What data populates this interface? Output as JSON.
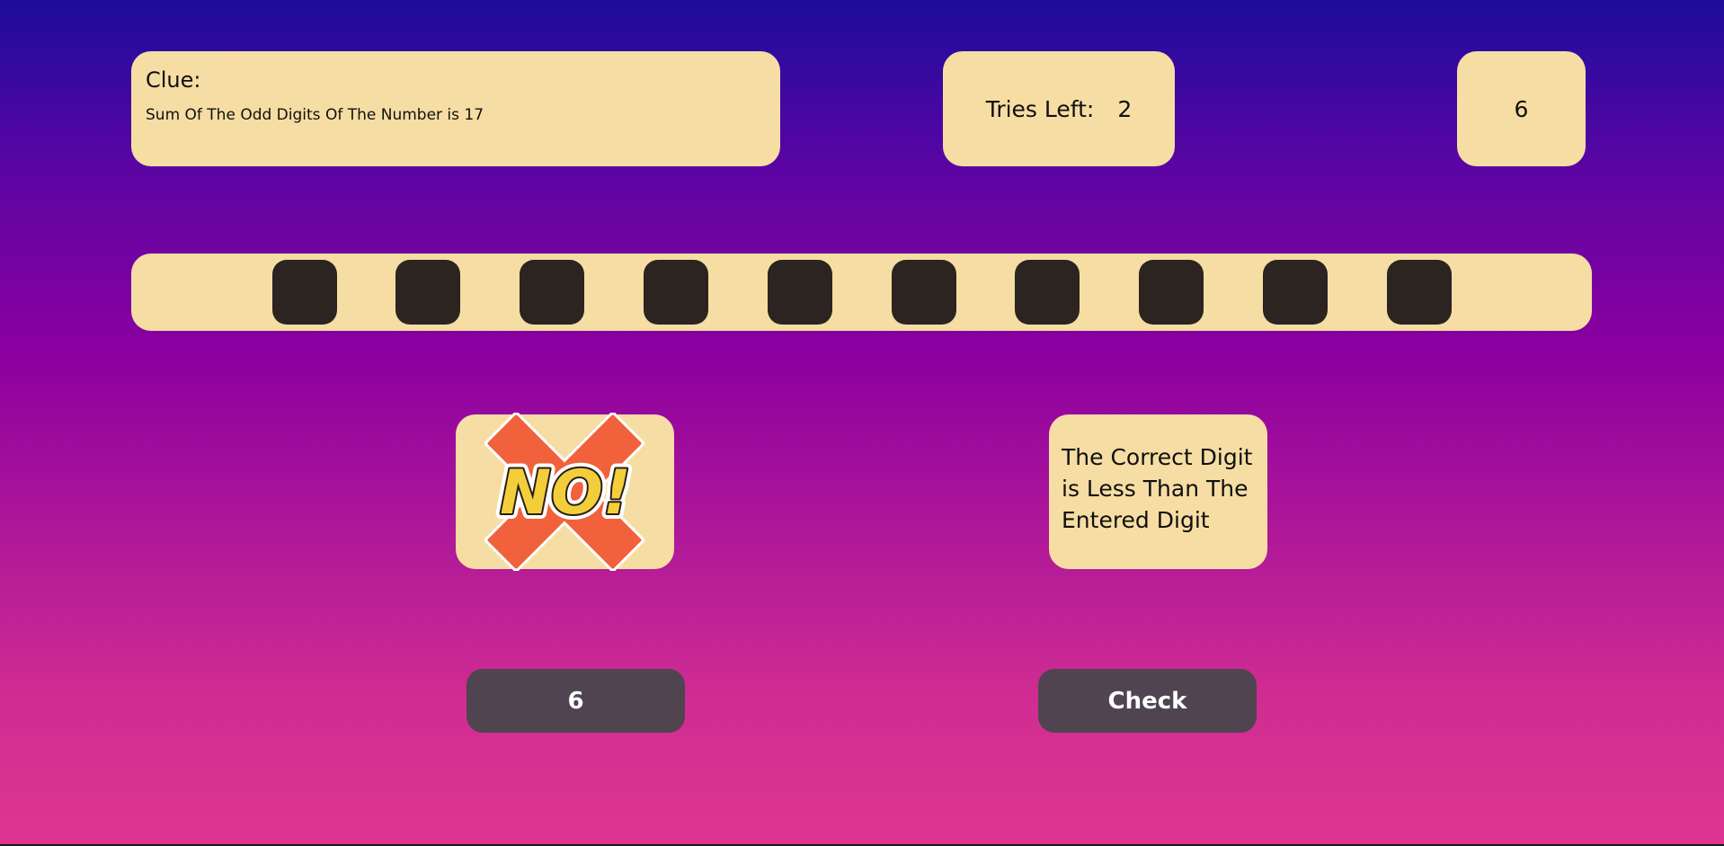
{
  "clue": {
    "heading": "Clue:",
    "text": "Sum Of The Odd Digits Of The Number is 17"
  },
  "tries": {
    "label": "Tries Left:",
    "value": "2"
  },
  "score": {
    "value": "6"
  },
  "slots": {
    "count": 10,
    "color": "#2b2420"
  },
  "verdict": {
    "stamp_text": "NO!",
    "icon": "no-x-icon"
  },
  "hint": {
    "text": "The Correct Digit is Less Than The Entered Digit"
  },
  "controls": {
    "digit_value": "6",
    "check_label": "Check"
  },
  "colors": {
    "panel": "#f6dda3",
    "button": "#4f444f",
    "stamp_x": "#f1613b",
    "stamp_text": "#f2cf3a"
  }
}
